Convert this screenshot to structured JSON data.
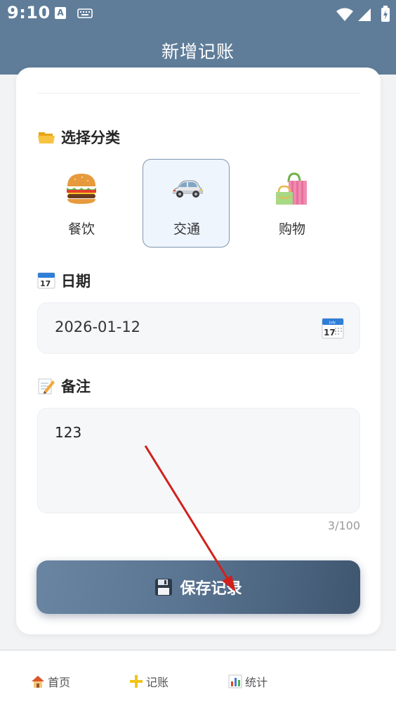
{
  "status_bar": {
    "time": "9:10",
    "notification_letter": "A"
  },
  "header": {
    "title": "新增记账"
  },
  "category_section": {
    "title": "选择分类",
    "items": [
      {
        "label": "餐饮",
        "icon": "hamburger-icon",
        "selected": false
      },
      {
        "label": "交通",
        "icon": "car-icon",
        "selected": true
      },
      {
        "label": "购物",
        "icon": "shopping-bags-icon",
        "selected": false
      }
    ]
  },
  "date_section": {
    "title": "日期",
    "value": "2026-01-12",
    "calendar_day": "17",
    "calendar_month": "July"
  },
  "note_section": {
    "title": "备注",
    "value": "123",
    "counter": "3/100"
  },
  "save_button": {
    "label": "保存记录"
  },
  "bottom_nav": {
    "items": [
      {
        "label": "首页",
        "icon": "house-icon"
      },
      {
        "label": "记账",
        "icon": "plus-icon"
      },
      {
        "label": "统计",
        "icon": "bar-chart-icon"
      }
    ]
  },
  "colors": {
    "header": "#5f7d99",
    "selected_border": "#7f97ad",
    "selected_bg": "#eef5fd",
    "arrow": "#d0211c"
  }
}
